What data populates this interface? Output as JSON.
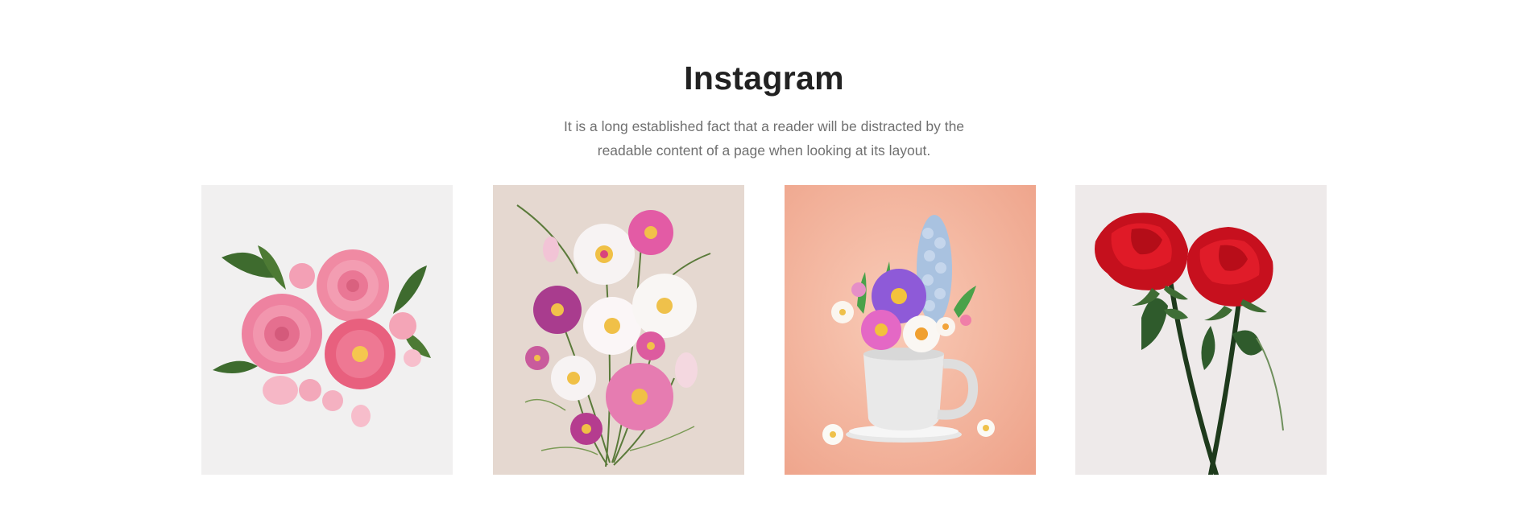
{
  "instagram": {
    "title": "Instagram",
    "description": "It is a long established fact that a reader will be distracted by the readable content of a page when looking at its layout.",
    "posts": [
      {
        "icon": "pink-roses-bouquet-image",
        "bg": "#f1f0f0"
      },
      {
        "icon": "cosmos-flowers-illustration-image",
        "bg": "#e5d8d0"
      },
      {
        "icon": "flower-mug-image",
        "bg": "#f0ab92"
      },
      {
        "icon": "red-roses-image",
        "bg": "#eeeaea"
      }
    ]
  }
}
